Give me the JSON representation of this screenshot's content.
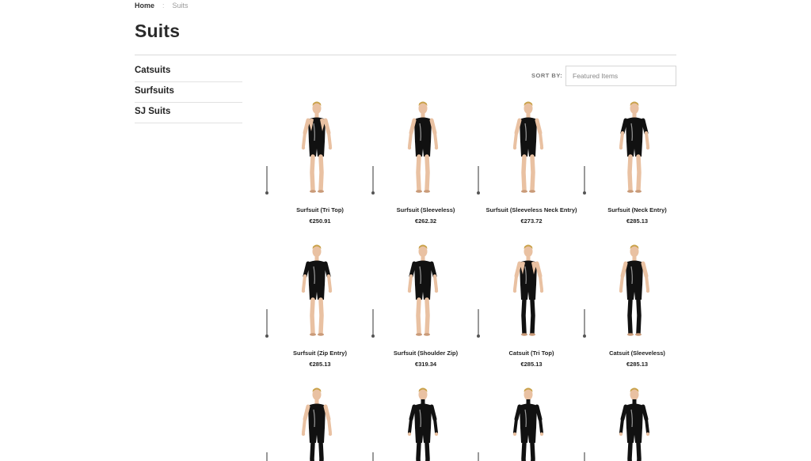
{
  "breadcrumb": {
    "home": "Home",
    "separator": ":",
    "current": "Suits"
  },
  "page": {
    "title": "Suits"
  },
  "sidebar": {
    "items": [
      {
        "label": "Catsuits"
      },
      {
        "label": "Surfsuits"
      },
      {
        "label": "SJ Suits"
      }
    ]
  },
  "sort": {
    "label": "SORT BY:",
    "selected": "Featured Items"
  },
  "products": [
    {
      "name": "Surfsuit (Tri Top)",
      "price": "€250.91",
      "style": "tri"
    },
    {
      "name": "Surfsuit (Sleeveless)",
      "price": "€262.32",
      "style": "sleeveless"
    },
    {
      "name": "Surfsuit (Sleeveless Neck Entry)",
      "price": "€273.72",
      "style": "sleeveless"
    },
    {
      "name": "Surfsuit (Neck Entry)",
      "price": "€285.13",
      "style": "short"
    },
    {
      "name": "Surfsuit (Zip Entry)",
      "price": "€285.13",
      "style": "short"
    },
    {
      "name": "Surfsuit (Shoulder Zip)",
      "price": "€319.34",
      "style": "short"
    },
    {
      "name": "Catsuit (Tri Top)",
      "price": "€285.13",
      "style": "tri-long"
    },
    {
      "name": "Catsuit (Sleeveless)",
      "price": "€285.13",
      "style": "sleeveless-long"
    },
    {
      "name": "",
      "price": "",
      "style": "sleeveless-long"
    },
    {
      "name": "",
      "price": "",
      "style": "full"
    },
    {
      "name": "",
      "price": "",
      "style": "full"
    },
    {
      "name": "",
      "price": "",
      "style": "full"
    }
  ]
}
